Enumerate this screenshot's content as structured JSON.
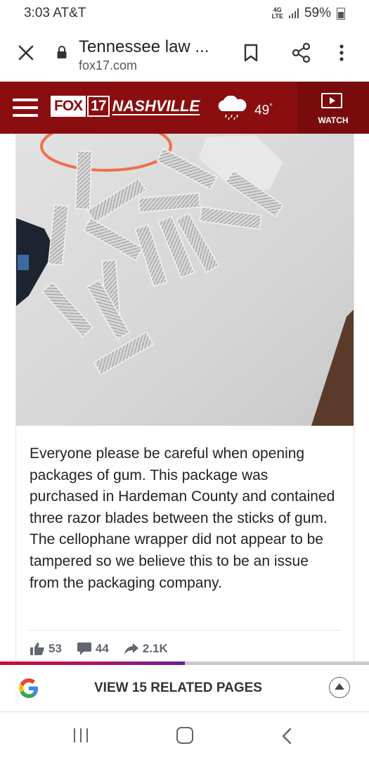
{
  "status_bar": {
    "time": "3:03 AT&T",
    "network_top": "4G",
    "network_bottom": "LTE",
    "battery": "59%"
  },
  "browser": {
    "title": "Tennessee law ...",
    "domain": "fox17.com",
    "icons": [
      "close-icon",
      "lock-icon",
      "bookmark-icon",
      "share-icon",
      "more-icon"
    ]
  },
  "site_header": {
    "logo_fox": "FOX",
    "logo_number": "17",
    "logo_city": "NASHVILLE",
    "temperature": "49",
    "degree_symbol": "°",
    "watch_label": "WATCH",
    "brand_color": "#8a0e0f"
  },
  "post": {
    "image_description_icon": "photo",
    "body": "Everyone please be careful when opening packages of gum. This package was purchased in Hardeman County and contained three razor blades between the sticks of gum. The cellophane wrapper did not appear to be tampered so we believe this to be an issue from the packaging company.",
    "likes": "53",
    "comments": "44",
    "shares": "2.1K"
  },
  "reading_progress": 0.5,
  "related": {
    "label": "VIEW 15 RELATED PAGES"
  }
}
